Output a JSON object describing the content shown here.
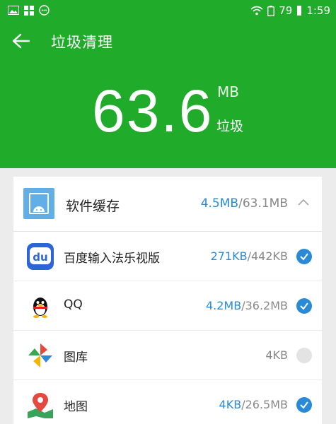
{
  "status_bar": {
    "battery": "79",
    "time": "1:59",
    "left_icons": [
      "image-icon",
      "apps-grid-icon",
      "chat-bubble-icon"
    ],
    "right_icons": [
      "wifi-icon",
      "battery-icon"
    ]
  },
  "toolbar": {
    "title": "垃圾清理",
    "back_icon": "back-arrow-icon"
  },
  "summary": {
    "size": "63.6",
    "unit": "MB",
    "label": "垃圾"
  },
  "section": {
    "title": "软件缓存",
    "selected_size": "4.5MB",
    "separator": "/",
    "total_size": "63.1MB",
    "expanded": true
  },
  "items": [
    {
      "name": "百度输入法乐视版",
      "selected": "271KB",
      "sep": "/",
      "total": "442KB",
      "checked": true,
      "icon": "baidu-input-icon"
    },
    {
      "name": "QQ",
      "selected": "4.2MB",
      "sep": "/",
      "total": "36.2MB",
      "checked": true,
      "icon": "qq-penguin-icon"
    },
    {
      "name": "图库",
      "selected": "",
      "sep": "",
      "total": "4KB",
      "checked": false,
      "icon": "gallery-pinwheel-icon"
    },
    {
      "name": "地图",
      "selected": "4KB",
      "sep": "/",
      "total": "26.5MB",
      "checked": true,
      "icon": "map-pin-icon"
    }
  ],
  "colors": {
    "header_green": "#21ab2b",
    "accent_blue": "#2a8ad6"
  }
}
